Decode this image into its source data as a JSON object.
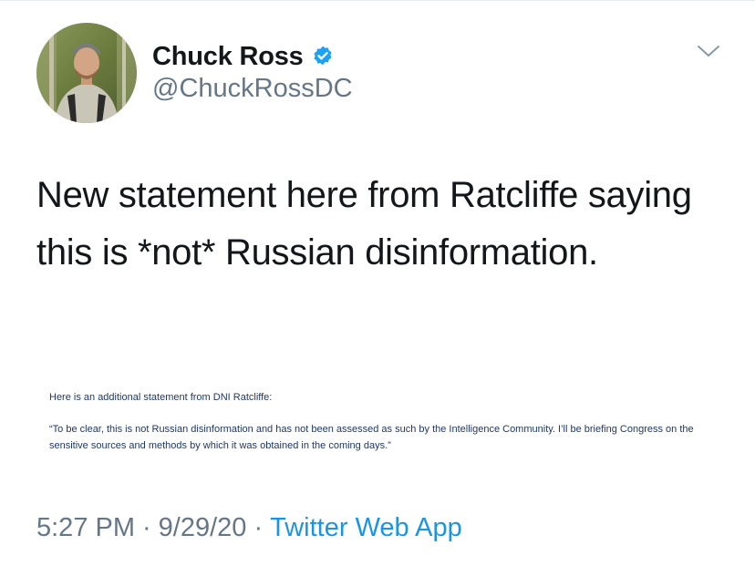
{
  "tweet": {
    "author": {
      "display_name": "Chuck Ross",
      "handle": "@ChuckRossDC",
      "verified": true
    },
    "text": "New statement here from Ratcliffe saying this is *not* Russian disinformation.",
    "attached_image": {
      "intro": "Here is an additional statement from DNI Ratcliffe:",
      "quote": "“To be clear, this is not Russian disinformation and has not been assessed as such by the Intelligence Community.  I’ll be briefing Congress on the sensitive sources and methods by which it was obtained in the coming days.”"
    },
    "meta": {
      "time": "5:27 PM",
      "separator": "·",
      "date": "9/29/20",
      "source": "Twitter Web App"
    }
  },
  "icons": {
    "verified": "verified-badge-icon",
    "menu": "chevron-down-icon"
  },
  "colors": {
    "text": "#14171a",
    "secondary": "#657786",
    "link": "#1b95e0",
    "verified": "#1da1f2",
    "document_text": "#1f3864"
  }
}
